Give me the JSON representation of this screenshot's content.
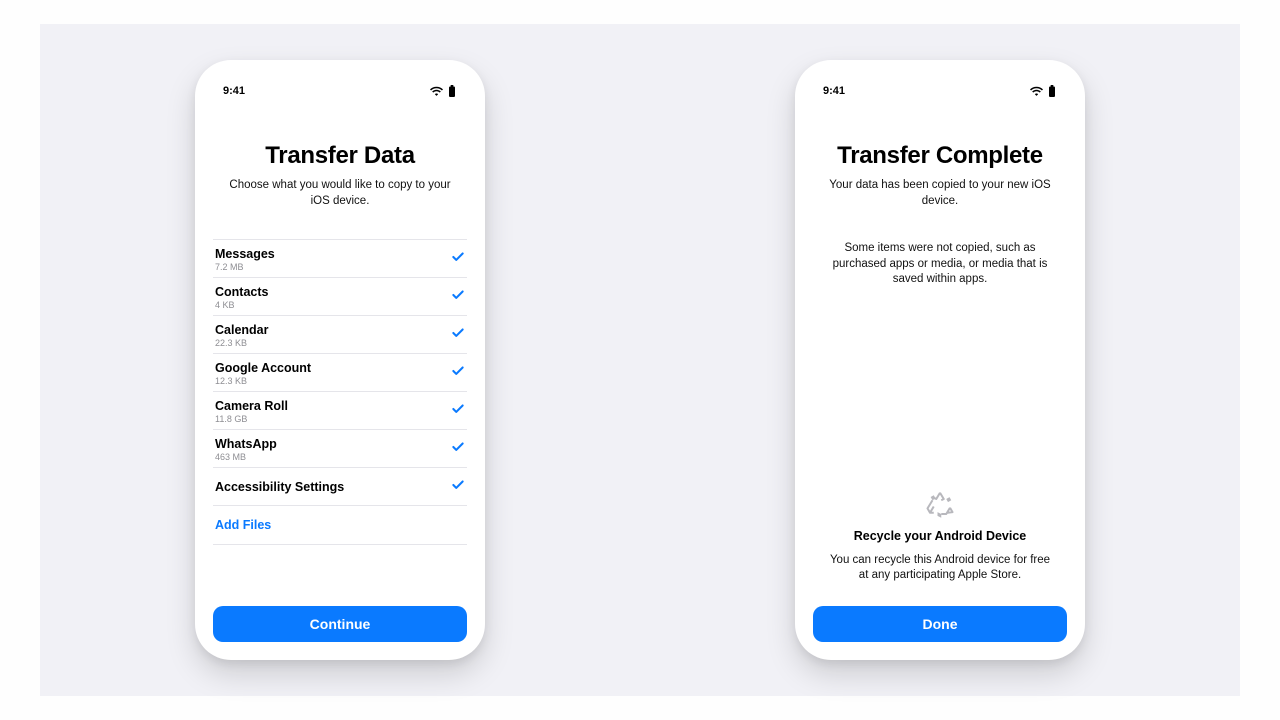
{
  "status": {
    "time": "9:41"
  },
  "left": {
    "title": "Transfer Data",
    "subtitle": "Choose what you would like to copy to your iOS device.",
    "items": [
      {
        "label": "Messages",
        "meta": "7.2 MB"
      },
      {
        "label": "Contacts",
        "meta": "4 KB"
      },
      {
        "label": "Calendar",
        "meta": "22.3 KB"
      },
      {
        "label": "Google Account",
        "meta": "12.3 KB"
      },
      {
        "label": "Camera Roll",
        "meta": "11.8 GB"
      },
      {
        "label": "WhatsApp",
        "meta": "463 MB"
      },
      {
        "label": "Accessibility Settings",
        "meta": ""
      }
    ],
    "add_files": "Add Files",
    "continue": "Continue"
  },
  "right": {
    "title": "Transfer Complete",
    "subtitle": "Your data has been copied to your new iOS device.",
    "note": "Some items were not copied, such as purchased apps or media, or media that is saved within apps.",
    "recycle_title": "Recycle your Android Device",
    "recycle_body": "You can recycle this Android device for free at any participating Apple Store.",
    "done": "Done"
  }
}
